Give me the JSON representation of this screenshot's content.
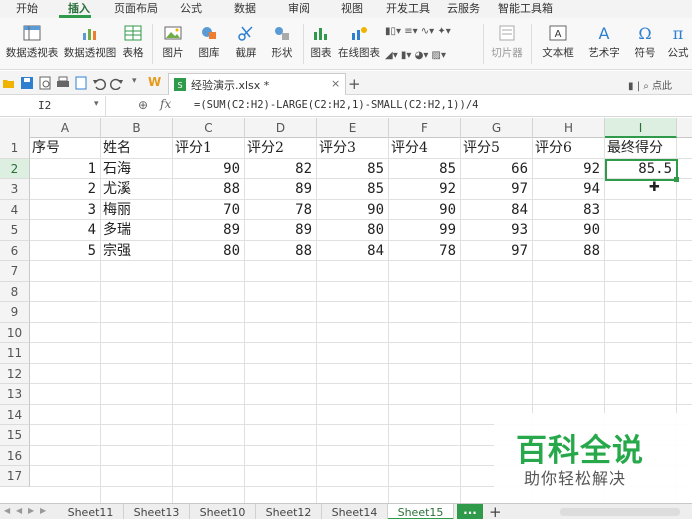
{
  "menu": {
    "tabs": [
      "开始",
      "插入",
      "页面布局",
      "公式",
      "数据",
      "审阅",
      "视图",
      "开发工具",
      "云服务",
      "智能工具箱"
    ],
    "active_tab": "插入"
  },
  "ribbon": {
    "pivot_table": "数据透视表",
    "pivot_chart": "数据透视图",
    "table": "表格",
    "picture": "图片",
    "gallery": "图库",
    "screenshot": "截屏",
    "shapes": "形状",
    "chart": "图表",
    "online_chart": "在线图表",
    "slicer": "切片器",
    "textbox": "文本框",
    "wordart": "艺术字",
    "symbol": "符号",
    "formula": "公式"
  },
  "file_tab": {
    "name": "经验演示.xlsx *",
    "close": "×",
    "new": "+",
    "wps": "W"
  },
  "right_tools": "点此",
  "formula_bar": {
    "cell_ref": "I2",
    "fx": "fx",
    "formula": "=(SUM(C2:H2)-LARGE(C2:H2,1)-SMALL(C2:H2,1))/4"
  },
  "sheet": {
    "columns": [
      "A",
      "B",
      "C",
      "D",
      "E",
      "F",
      "G",
      "H",
      "I"
    ],
    "row_numbers": [
      "1",
      "2",
      "3",
      "4",
      "5",
      "6",
      "7",
      "8",
      "9",
      "10",
      "11",
      "12",
      "13",
      "14",
      "15",
      "16",
      "17"
    ],
    "header": [
      "序号",
      "姓名",
      "评分1",
      "评分2",
      "评分3",
      "评分4",
      "评分5",
      "评分6",
      "最终得分"
    ],
    "rows": [
      [
        "1",
        "石海",
        "90",
        "82",
        "85",
        "85",
        "66",
        "92",
        "85.5"
      ],
      [
        "2",
        "尤溪",
        "88",
        "89",
        "85",
        "92",
        "97",
        "94",
        ""
      ],
      [
        "3",
        "梅丽",
        "70",
        "78",
        "90",
        "90",
        "84",
        "83",
        ""
      ],
      [
        "4",
        "多瑞",
        "89",
        "89",
        "80",
        "99",
        "93",
        "90",
        ""
      ],
      [
        "5",
        "宗强",
        "80",
        "88",
        "84",
        "78",
        "97",
        "88",
        ""
      ]
    ]
  },
  "watermark": {
    "title": "百科全说",
    "subtitle": "助你轻松解决"
  },
  "sheet_tabs": [
    "Sheet11",
    "Sheet13",
    "Sheet10",
    "Sheet12",
    "Sheet14",
    "Sheet15"
  ],
  "active_sheet": "Sheet15",
  "more_tabs": "...",
  "add_sheet": "+",
  "colors": {
    "accent": "#2f9a4a",
    "watermark_green": "#27a84a"
  }
}
